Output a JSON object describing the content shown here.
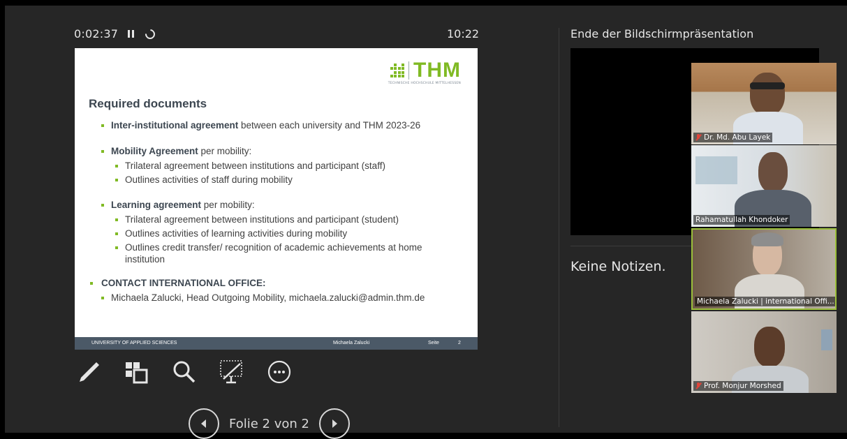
{
  "presenter": {
    "elapsed": "0:02:37",
    "clock": "10:22"
  },
  "slide": {
    "logo_word": "THM",
    "logo_subtitle": "TECHNISCHE HOCHSCHULE MITTELHESSEN",
    "title": "Required documents",
    "items": {
      "inter_bold": "Inter-institutional agreement",
      "inter_rest": " between each university and THM 2023-26",
      "mobility_bold": "Mobility Agreement",
      "mobility_rest": " per mobility:",
      "mobility_sub1": "Trilateral agreement between institutions and participant (staff)",
      "mobility_sub2": "Outlines activities of staff during mobility",
      "learning_bold": "Learning agreement",
      "learning_rest": " per mobility:",
      "learning_sub1": "Trilateral agreement between institutions and participant (student)",
      "learning_sub2": "Outlines activities of learning activities during mobility",
      "learning_sub3": "Outlines credit transfer/ recognition of academic achievements at home institution",
      "contact_heading": "CONTACT INTERNATIONAL OFFICE:",
      "contact_line": "Michaela Zalucki, Head Outgoing Mobility, michaela.zalucki@admin.thm.de"
    },
    "footer": {
      "left": "UNIVERSITY OF APPLIED SCIENCES",
      "presenter": "Michaela Zalucki",
      "page_label": "Seite",
      "page_number": "2"
    }
  },
  "tools": {
    "pen": "pen-icon",
    "slides": "all-slides-icon",
    "zoom": "zoom-icon",
    "black_screen": "black-screen-icon",
    "more": "more-options-icon"
  },
  "navigation": {
    "label": "Folie 2 von 2"
  },
  "right_pane": {
    "next_slide_title": "Ende der Bildschirmpräsentation",
    "notes": "Keine Notizen."
  },
  "participants": [
    {
      "name": "Dr. Md. Abu Layek",
      "muted": true
    },
    {
      "name": "Rahamatullah Khondoker",
      "muted": false
    },
    {
      "name": "Michaela Zalucki | international Offi...",
      "muted": false,
      "active_speaker": true
    },
    {
      "name": "Prof. Monjur Morshed",
      "muted": true
    }
  ],
  "colors": {
    "accent_green": "#80ba24",
    "background": "#262626",
    "slide_footer": "#4b5967",
    "muted_red": "#e0443a",
    "active_speaker_border": "#9bbf3a"
  }
}
